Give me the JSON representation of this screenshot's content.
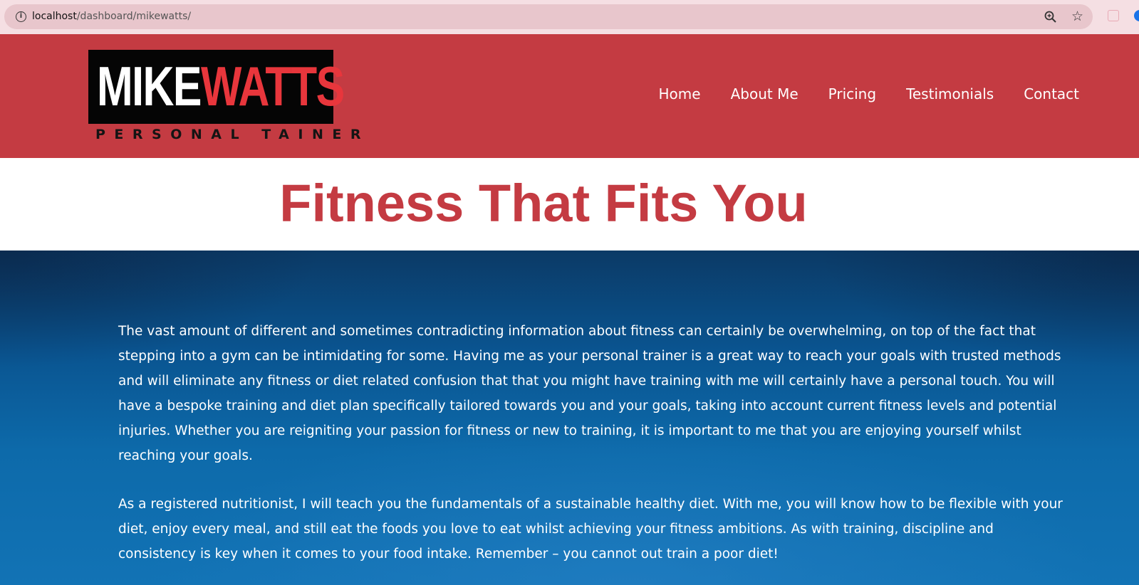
{
  "browser": {
    "url_host": "localhost",
    "url_path": "/dashboard/mikewatts/",
    "info_icon": "info-icon",
    "zoom_icon": "zoom-icon",
    "star_icon": "star-icon"
  },
  "header": {
    "logo": {
      "first": "MIKE",
      "second": "WATTS",
      "tagline": "PERSONAL TAINER"
    },
    "nav": {
      "home": "Home",
      "about": "About Me",
      "pricing": "Pricing",
      "testimonials": "Testimonials",
      "contact": "Contact"
    },
    "colors": {
      "header_bg": "#c43b42",
      "logo_accent": "#e8363c"
    }
  },
  "title": "Fitness That Fits You",
  "hero": {
    "paragraph_1": "The vast amount of different and sometimes contradicting information about fitness can certainly be overwhelming, on top of the fact that stepping into a gym can be intimidating for some. Having me as your personal trainer is a great way to reach your goals with trusted methods and will eliminate any fitness or diet related confusion that that you might have training with me will certainly have a personal touch. You will have a bespoke training and diet plan specifically tailored towards you and your goals, taking into account current fitness levels and potential injuries. Whether you are reigniting your passion for fitness or new to training, it is important to me that you are enjoying yourself whilst reaching your goals.",
    "paragraph_2": "As a registered nutritionist, I will teach you the fundamentals of a sustainable healthy diet. With me, you will know how to be flexible with your diet, enjoy every meal, and still eat the foods you love to eat whilst achieving your fitness ambitions. As with training, discipline and consistency is key when it comes to your food intake. Remember – you cannot out train a poor diet!"
  }
}
